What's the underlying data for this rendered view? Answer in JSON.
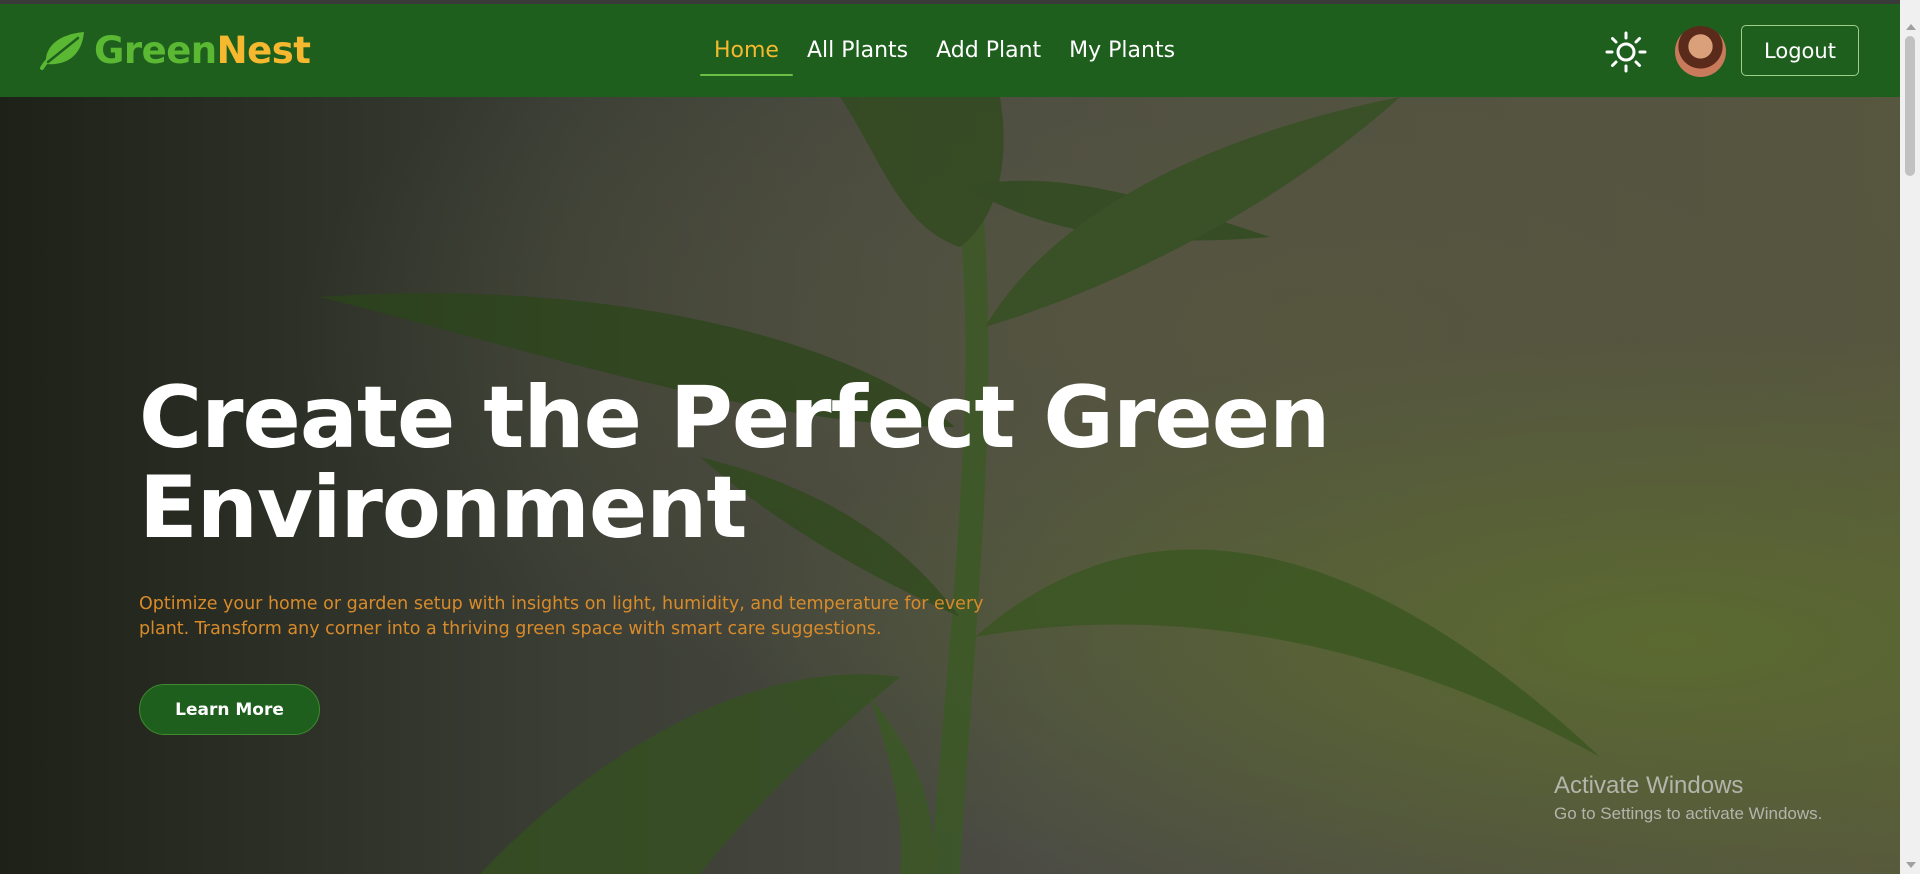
{
  "brand": {
    "name_part1": "Green",
    "name_part2": "Nest",
    "logo_icon": "leaf-icon"
  },
  "nav": {
    "items": [
      {
        "label": "Home",
        "active": true
      },
      {
        "label": "All Plants",
        "active": false
      },
      {
        "label": "Add Plant",
        "active": false
      },
      {
        "label": "My Plants",
        "active": false
      }
    ]
  },
  "header_actions": {
    "theme_icon": "sun-icon",
    "avatar": "user-avatar",
    "logout_label": "Logout"
  },
  "hero": {
    "title": "Create the Perfect Green Environment",
    "description": "Optimize your home or garden setup with insights on light, humidity, and temperature for every plant. Transform any corner into a thriving green space with smart care suggestions.",
    "cta_label": "Learn More"
  },
  "os_watermark": {
    "title": "Activate Windows",
    "subtitle": "Go to Settings to activate Windows."
  },
  "colors": {
    "navbar": "#1f5f1e",
    "brand_green": "#5ab833",
    "brand_accent": "#f5b82e",
    "active_link": "#f5b82e",
    "description_text": "#d98b2a",
    "cta_background": "#1f5f1e"
  }
}
